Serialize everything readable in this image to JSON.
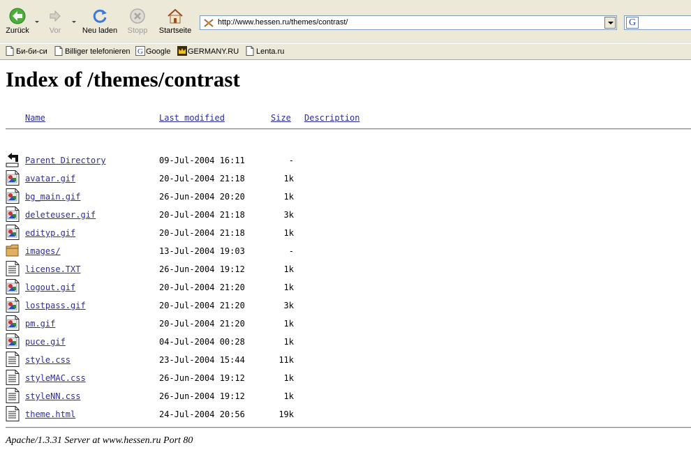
{
  "toolbar": {
    "back_label": "Zurück",
    "forward_label": "Vor",
    "reload_label": "Neu laden",
    "stop_label": "Stopp",
    "home_label": "Startseite"
  },
  "address_bar": {
    "url": "http://www.hessen.ru/themes/contrast/"
  },
  "search_box": {
    "engine_glyph": "G"
  },
  "bookmarks": [
    {
      "label": "Би-би-си",
      "icon": "page-icon"
    },
    {
      "label": "Billiger telefonieren",
      "icon": "page-icon"
    },
    {
      "label": "Google",
      "icon": "google-icon"
    },
    {
      "label": "GERMANY.RU",
      "icon": "crown-icon"
    },
    {
      "label": "Lenta.ru",
      "icon": "page-icon"
    }
  ],
  "page": {
    "title": "Index of /themes/contrast",
    "columns": {
      "name": "Name",
      "last_modified": "Last modified",
      "size": "Size",
      "description": "Description"
    },
    "entries": [
      {
        "name": "Parent Directory",
        "modified": "09-Jul-2004 16:11",
        "size": "-",
        "icon": "back-arrow-icon"
      },
      {
        "name": "avatar.gif",
        "modified": "20-Jul-2004 21:18",
        "size": "1k",
        "icon": "image-file-icon"
      },
      {
        "name": "bg_main.gif",
        "modified": "26-Jun-2004 20:20",
        "size": "1k",
        "icon": "image-file-icon"
      },
      {
        "name": "deleteuser.gif",
        "modified": "20-Jul-2004 21:18",
        "size": "3k",
        "icon": "image-file-icon"
      },
      {
        "name": "edityp.gif",
        "modified": "20-Jul-2004 21:18",
        "size": "1k",
        "icon": "image-file-icon"
      },
      {
        "name": "images/",
        "modified": "13-Jul-2004 19:03",
        "size": "-",
        "icon": "folder-icon"
      },
      {
        "name": "license.TXT",
        "modified": "26-Jun-2004 19:12",
        "size": "1k",
        "icon": "text-file-icon"
      },
      {
        "name": "logout.gif",
        "modified": "20-Jul-2004 21:20",
        "size": "1k",
        "icon": "image-file-icon"
      },
      {
        "name": "lostpass.gif",
        "modified": "20-Jul-2004 21:20",
        "size": "3k",
        "icon": "image-file-icon"
      },
      {
        "name": "pm.gif",
        "modified": "20-Jul-2004 21:20",
        "size": "1k",
        "icon": "image-file-icon"
      },
      {
        "name": "puce.gif",
        "modified": "04-Jul-2004 00:28",
        "size": "1k",
        "icon": "image-file-icon"
      },
      {
        "name": "style.css",
        "modified": "23-Jul-2004 15:44",
        "size": "11k",
        "icon": "text-file-icon"
      },
      {
        "name": "styleMAC.css",
        "modified": "26-Jun-2004 19:12",
        "size": "1k",
        "icon": "text-file-icon"
      },
      {
        "name": "styleNN.css",
        "modified": "26-Jun-2004 19:12",
        "size": "1k",
        "icon": "text-file-icon"
      },
      {
        "name": "theme.html",
        "modified": "24-Jul-2004 20:56",
        "size": "19k",
        "icon": "text-file-icon"
      }
    ],
    "server_signature": "Apache/1.3.31 Server at www.hessen.ru Port 80"
  }
}
